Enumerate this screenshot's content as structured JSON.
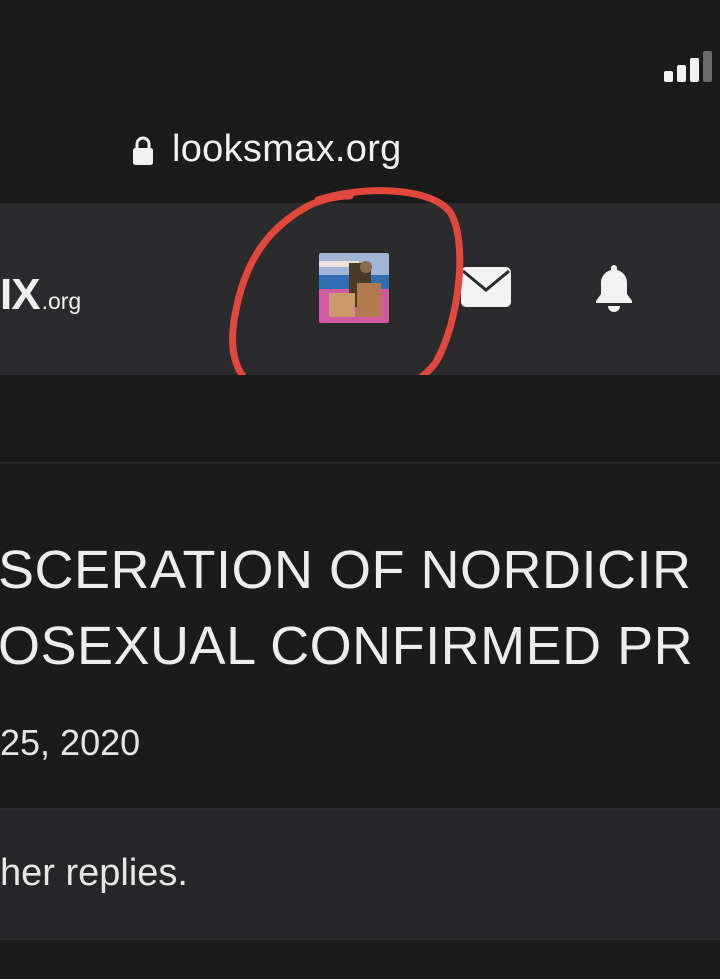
{
  "browser": {
    "url": "looksmax.org",
    "lock_icon": "lock-icon",
    "signal_icon": "cellular-signal-icon"
  },
  "header": {
    "logo_main": "IX",
    "logo_suffix": ".org",
    "avatar_icon": "user-avatar-image",
    "mail_icon": "envelope-icon",
    "bell_icon": "bell-icon",
    "annotation_color": "#e1473d"
  },
  "thread": {
    "title_line1": "SCERATION OF NORDICIR",
    "title_line2": "OSEXUAL CONFIRMED PR",
    "date": "25, 2020",
    "replies_notice": "her replies."
  },
  "colors": {
    "background": "#1b1b1c",
    "header_bg": "#2b2b2d",
    "text": "#ececec"
  }
}
